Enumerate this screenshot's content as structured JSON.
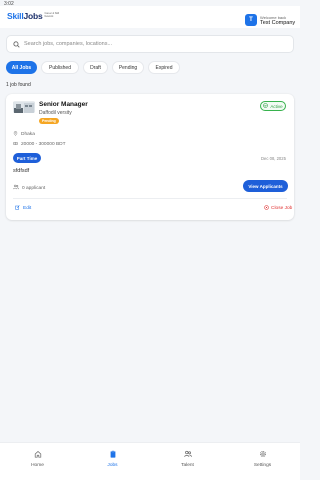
{
  "status": {
    "time": "3:02"
  },
  "header": {
    "logo_main": "Skill",
    "logo_bold": "Jobs",
    "logo_tagline": "Career & Skill Network",
    "avatar_letter": "T",
    "welcome_label": "Welcome back",
    "company_name": "Test Company"
  },
  "search": {
    "placeholder": "Search jobs, companies, locations..."
  },
  "tabs": [
    {
      "label": "All Jobs",
      "active": true
    },
    {
      "label": "Published"
    },
    {
      "label": "Draft"
    },
    {
      "label": "Pending"
    },
    {
      "label": "Expired"
    }
  ],
  "results": {
    "count_text": "1 job found"
  },
  "job": {
    "title": "Senior Manager",
    "company": "Daffodil versity",
    "review_status": "Pending",
    "status": "Active",
    "location": "Dhaka",
    "salary": "20000 - 300000 BDT",
    "job_type": "Part Time",
    "posted_date": "Dec 08, 2025",
    "description": "sfdfsdf",
    "applicants": "0 applicant",
    "view_label": "View Applicants",
    "edit_label": "Edit",
    "close_label": "Close Job"
  },
  "nav": [
    {
      "label": "Home",
      "icon": "home-icon"
    },
    {
      "label": "Jobs",
      "icon": "clipboard-icon",
      "active": true
    },
    {
      "label": "Talent",
      "icon": "users-icon"
    },
    {
      "label": "Settings",
      "icon": "gear-icon"
    }
  ],
  "colors": {
    "primary": "#1e73e8",
    "active_green": "#2f9e44",
    "pending": "#f5a623",
    "danger": "#e03131"
  }
}
